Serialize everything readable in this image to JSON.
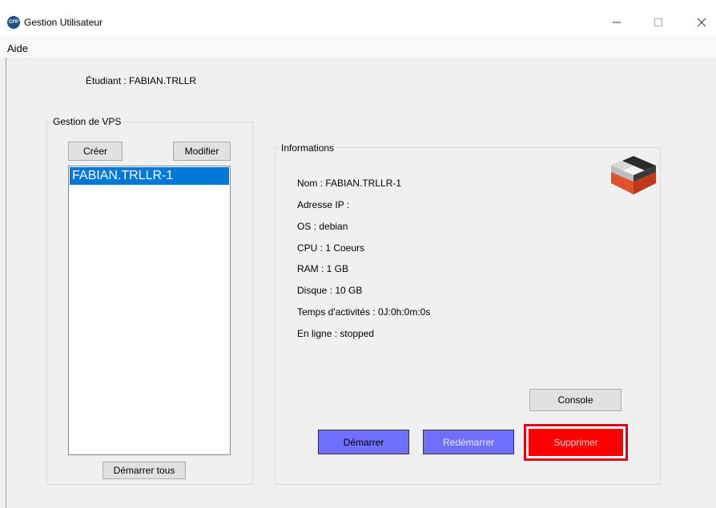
{
  "window": {
    "title": "Gestion Utilisateur",
    "icon_text": "CFP",
    "controls": [
      "minimize-icon",
      "maximize-icon",
      "close-icon"
    ]
  },
  "menu": {
    "items": [
      {
        "label": "Aide"
      }
    ]
  },
  "student_label": "Étudiant :  FABIAN.TRLLR",
  "vps_panel": {
    "title": "Gestion de VPS",
    "create_label": "Créer",
    "modify_label": "Modifier",
    "list": [
      "FABIAN.TRLLR-1"
    ],
    "start_all_label": "Démarrer tous"
  },
  "info_panel": {
    "title": "Informations",
    "lines": [
      "Nom : FABIAN.TRLLR-1",
      "Adresse IP :",
      "OS : debian",
      "CPU : 1 Coeurs",
      "RAM : 1 GB",
      "Disque : 10 GB",
      "Temps d'activités : 0J:0h:0m:0s",
      "En ligne : stopped"
    ],
    "logo_icon": "server-blocks-icon",
    "console_label": "Console",
    "start_label": "Démarrer",
    "restart_label": "Redémarrer",
    "delete_label": "Supprimer"
  },
  "colors": {
    "selection": "#0078d7",
    "action_blue": "#7070ff",
    "delete_red": "#ff0000",
    "delete_focus_border": "#e0001b"
  }
}
